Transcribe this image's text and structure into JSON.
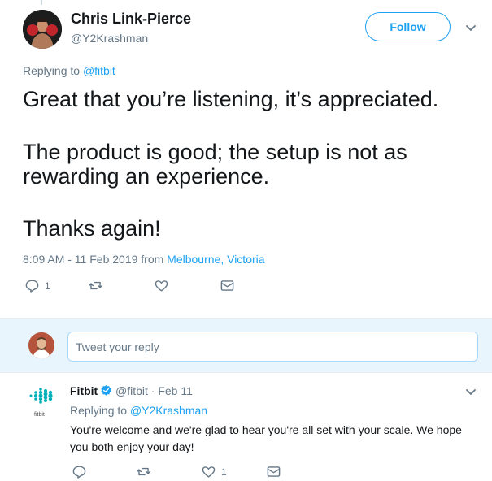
{
  "main_tweet": {
    "author_name": "Chris Link-Pierce",
    "author_handle": "@Y2Krashman",
    "follow_label": "Follow",
    "replying_prefix": "Replying to",
    "replying_to": "@fitbit",
    "paragraphs": [
      "Great that you’re listening, it’s appreciated.",
      "The product is good; the setup is not as",
      "rewarding an experience.",
      "Thanks again!"
    ],
    "timestamp": "8:09 AM - 11 Feb 2019 from",
    "location": "Melbourne, Victoria",
    "actions": {
      "reply_count": "1",
      "retweet_count": "",
      "like_count": ""
    }
  },
  "reply_box": {
    "placeholder": "Tweet your reply"
  },
  "reply_tweet": {
    "author_name": "Fitbit",
    "handle_date": "@fitbit · Feb 11",
    "logo_text": "fitbit",
    "replying_prefix": "Replying to",
    "replying_to": "@Y2Krashman",
    "body": "You're welcome and we're glad to hear you're all set with your scale. We hope you both enjoy your day!",
    "actions": {
      "reply_count": "",
      "retweet_count": "",
      "like_count": "1"
    }
  },
  "colors": {
    "accent": "#1da1f2",
    "secondary_text": "#657786",
    "fitbit_teal": "#00b0b9",
    "reply_bar_bg": "#e8f5fd"
  },
  "icons": [
    "chevron-down-icon",
    "reply-icon",
    "retweet-icon",
    "like-icon",
    "dm-icon",
    "verified-icon"
  ]
}
